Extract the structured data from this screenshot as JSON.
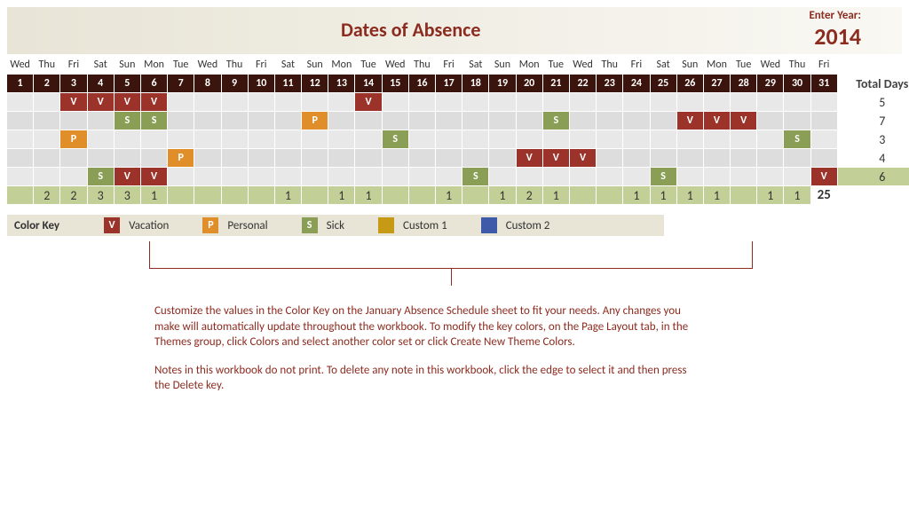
{
  "header": {
    "title": "Dates of Absence",
    "enter_year_label": "Enter Year:",
    "year": "2014",
    "total_days_label": "Total Days"
  },
  "days": [
    "Wed",
    "Thu",
    "Fri",
    "Sat",
    "Sun",
    "Mon",
    "Tue",
    "Wed",
    "Thu",
    "Fri",
    "Sat",
    "Sun",
    "Mon",
    "Tue",
    "Wed",
    "Thu",
    "Fri",
    "Sat",
    "Sun",
    "Mon",
    "Tue",
    "Wed",
    "Thu",
    "Fri",
    "Sat",
    "Sun",
    "Mon",
    "Tue",
    "Wed",
    "Thu",
    "Fri"
  ],
  "nums": [
    "1",
    "2",
    "3",
    "4",
    "5",
    "6",
    "7",
    "8",
    "9",
    "10",
    "11",
    "12",
    "13",
    "14",
    "15",
    "16",
    "17",
    "18",
    "19",
    "20",
    "21",
    "22",
    "23",
    "24",
    "25",
    "26",
    "27",
    "28",
    "29",
    "30",
    "31"
  ],
  "rows": [
    {
      "cells": [
        "",
        "",
        "V",
        "V",
        "V",
        "V",
        "",
        "",
        "",
        "",
        "",
        "",
        "",
        "V",
        "",
        "",
        "",
        "",
        "",
        "",
        "",
        "",
        "",
        "",
        "",
        "",
        "",
        "",
        "",
        "",
        ""
      ],
      "total": "5"
    },
    {
      "cells": [
        "",
        "",
        "",
        "",
        "S",
        "S",
        "",
        "",
        "",
        "",
        "",
        "P",
        "",
        "",
        "",
        "",
        "",
        "",
        "",
        "",
        "S",
        "",
        "",
        "",
        "",
        "V",
        "V",
        "V",
        "",
        "",
        ""
      ],
      "total": "7"
    },
    {
      "cells": [
        "",
        "",
        "P",
        "",
        "",
        "",
        "",
        "",
        "",
        "",
        "",
        "",
        "",
        "",
        "S",
        "",
        "",
        "",
        "",
        "",
        "",
        "",
        "",
        "",
        "",
        "",
        "",
        "",
        "",
        "S",
        ""
      ],
      "total": "3"
    },
    {
      "cells": [
        "",
        "",
        "",
        "",
        "",
        "",
        "P",
        "",
        "",
        "",
        "",
        "",
        "",
        "",
        "",
        "",
        "",
        "",
        "",
        "V",
        "V",
        "V",
        "",
        "",
        "",
        "",
        "",
        "",
        "",
        "",
        ""
      ],
      "total": "4"
    },
    {
      "cells": [
        "",
        "",
        "",
        "S",
        "V",
        "V",
        "",
        "",
        "",
        "",
        "",
        "",
        "",
        "",
        "",
        "",
        "",
        "S",
        "",
        "",
        "",
        "",
        "",
        "",
        "S",
        "",
        "",
        "",
        "",
        "",
        "V"
      ],
      "total": "6"
    }
  ],
  "sums": [
    "",
    "2",
    "2",
    "3",
    "3",
    "1",
    "",
    "",
    "",
    "",
    "1",
    "",
    "1",
    "1",
    "",
    "",
    "1",
    "",
    "1",
    "2",
    "1",
    "",
    "",
    "1",
    "1",
    "1",
    "1",
    "",
    "1",
    "1"
  ],
  "grand_total": "25",
  "key": {
    "label": "Color Key",
    "items": [
      {
        "code": "V",
        "label": "Vacation"
      },
      {
        "code": "P",
        "label": "Personal"
      },
      {
        "code": "S",
        "label": "Sick"
      },
      {
        "code": "",
        "label": "Custom 1",
        "cls": "C1"
      },
      {
        "code": "",
        "label": "Custom 2",
        "cls": "C2"
      }
    ]
  },
  "note": {
    "p1": "Customize the values in the Color Key on the January Absence Schedule sheet to fit your needs. Any changes you make will automatically update throughout the workbook.  To modify the key colors, on the Page Layout tab, in the Themes group, click Colors and select another color set or click Create New Theme Colors.",
    "p2": "Notes in this workbook do not print. To delete any note in this workbook, click the edge to select it and then press the Delete key."
  }
}
